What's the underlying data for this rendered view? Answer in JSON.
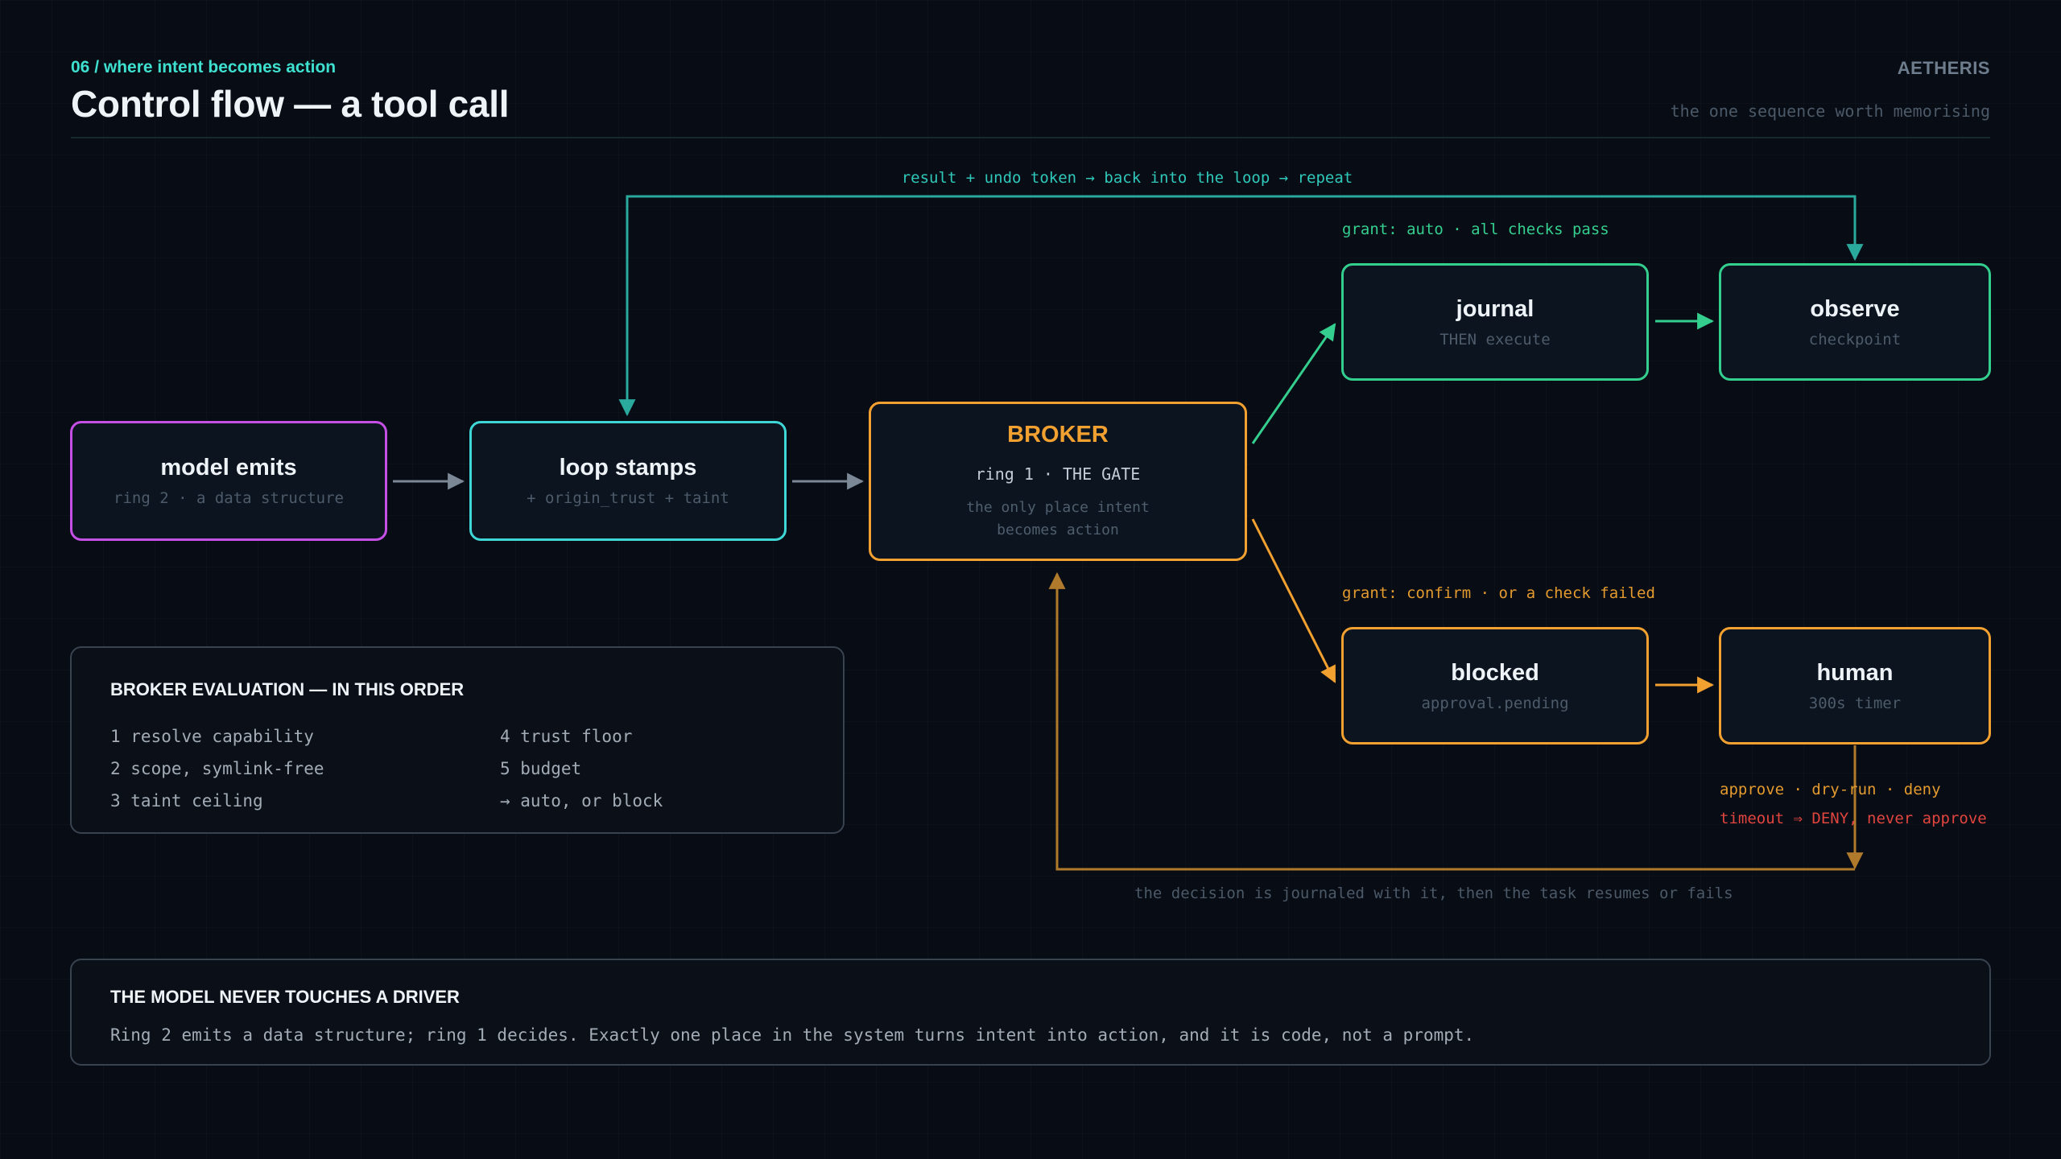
{
  "header": {
    "kicker": "06 / where intent becomes action",
    "title": "Control flow — a tool call",
    "brand": "AETHERIS",
    "tagline": "the one sequence worth memorising"
  },
  "nodes": {
    "model": {
      "title": "model emits",
      "sub": "ring 2 · a data structure"
    },
    "loop": {
      "title": "loop stamps",
      "sub": "+ origin_trust + taint"
    },
    "broker": {
      "title": "BROKER",
      "line": "ring 1 · THE GATE",
      "desc": "the only place intent becomes action"
    },
    "journal": {
      "title": "journal",
      "sub": "THEN execute"
    },
    "observe": {
      "title": "observe",
      "sub": "checkpoint"
    },
    "blocked": {
      "title": "blocked",
      "sub": "approval.pending"
    },
    "human": {
      "title": "human",
      "sub": "300s timer"
    }
  },
  "labels": {
    "loop_back": "result + undo token → back into the loop → repeat",
    "grant_auto": "grant: auto · all checks pass",
    "grant_confirm": "grant: confirm · or a check failed",
    "human_options": "approve · dry-run · deny",
    "timeout": "timeout ⇒ DENY, never approve",
    "decision": "the decision is journaled with it, then the task resumes or fails"
  },
  "evaluation": {
    "title": "BROKER EVALUATION — IN THIS ORDER",
    "left": [
      "1 resolve capability",
      "2 scope, symlink-free",
      "3 taint ceiling"
    ],
    "right": [
      "4 trust floor",
      "5 budget",
      "→ auto, or block"
    ]
  },
  "footer": {
    "title": "THE MODEL NEVER TOUCHES A DRIVER",
    "body": "Ring 2 emits a data structure; ring 1 decides. Exactly one place in the system turns intent into action, and it is code, not a prompt."
  },
  "colors": {
    "cyan": "#3fd6d6",
    "magenta": "#c64fe6",
    "orange": "#f2a131",
    "green": "#34cf8f",
    "teal": "#2aa99d",
    "red": "#e0453f",
    "gray_arrow": "#7b8896"
  }
}
